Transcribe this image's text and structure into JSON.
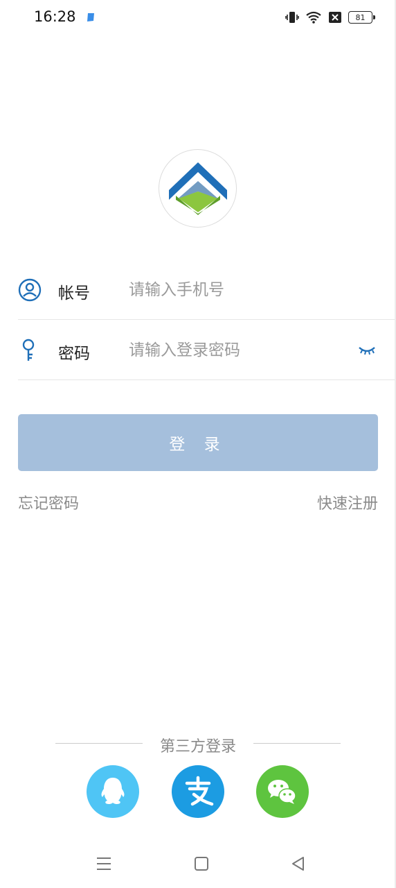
{
  "status_bar": {
    "time": "16:28",
    "battery_level": "81",
    "icons": [
      "app-notification-icon",
      "vibrate-icon",
      "wifi-icon",
      "no-sim-icon",
      "battery-icon"
    ]
  },
  "logo": {
    "icon": "house-chevron-logo",
    "colors": {
      "top": "#1f6fb8",
      "bottom": "#7cb83a"
    }
  },
  "form": {
    "account": {
      "label": "帐号",
      "placeholder": "请输入手机号",
      "value": "",
      "icon": "user-circle-icon"
    },
    "password": {
      "label": "密码",
      "placeholder": "请输入登录密码",
      "value": "",
      "icon": "key-icon",
      "toggle_icon": "eye-closed-icon"
    }
  },
  "login_button": {
    "label": "登 录",
    "color": "#a5bfdc"
  },
  "links": {
    "forgot_password": "忘记密码",
    "quick_register": "快速注册"
  },
  "third_party": {
    "title": "第三方登录",
    "providers": [
      {
        "name": "qq-icon",
        "color": "#4fc5f5"
      },
      {
        "name": "alipay-icon",
        "color": "#1c9ce2"
      },
      {
        "name": "wechat-icon",
        "color": "#5ec43f"
      }
    ]
  },
  "nav_bar": {
    "icons": [
      "menu-icon",
      "home-icon",
      "back-icon"
    ]
  },
  "theme": {
    "accent": "#1f6fb8",
    "text_muted": "#8a8a8a",
    "placeholder": "#9a9a9a"
  }
}
